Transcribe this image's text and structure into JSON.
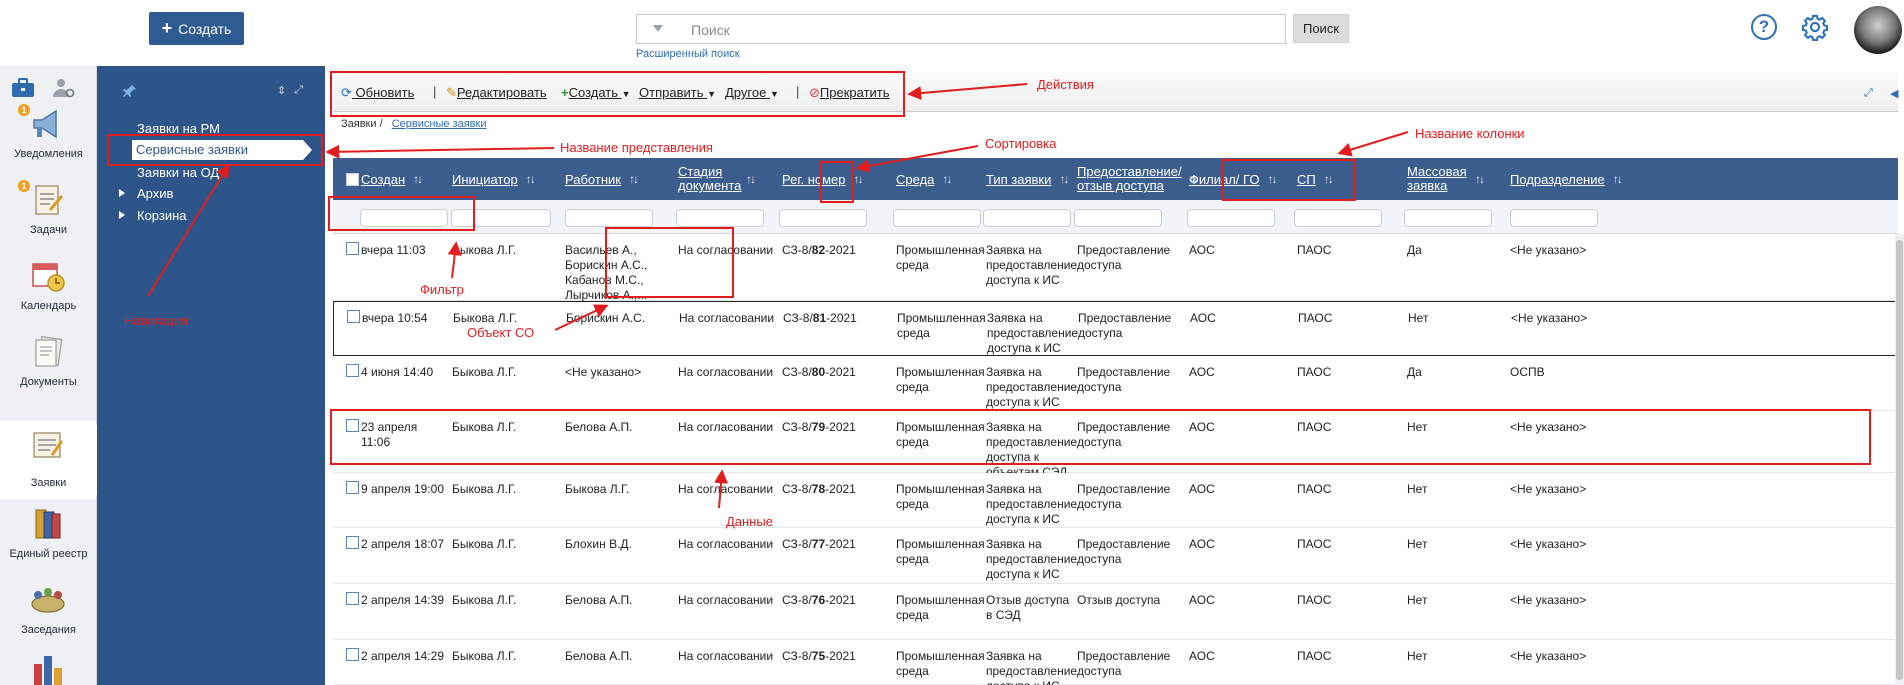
{
  "header": {
    "create_label": "Создать",
    "search_placeholder": "Поиск",
    "search_button": "Поиск",
    "advanced_search": "Расширенный поиск",
    "help_glyph": "?"
  },
  "nav": [
    {
      "label": "Уведомления",
      "badge": "1",
      "icon": "megaphone-icon"
    },
    {
      "label": "Задачи",
      "badge": "1",
      "icon": "clipboard-icon"
    },
    {
      "label": "Календарь",
      "badge": "",
      "icon": "calendar-icon"
    },
    {
      "label": "Документы",
      "badge": "",
      "icon": "documents-icon"
    },
    {
      "label": "Заявки",
      "badge": "",
      "icon": "requests-icon"
    },
    {
      "label": "Единый реестр",
      "badge": "",
      "icon": "registry-icon"
    },
    {
      "label": "Заседания",
      "badge": "",
      "icon": "meeting-icon"
    }
  ],
  "tree": {
    "items": [
      "Заявки на РМ",
      "Сервисные заявки",
      "Заявки на ОД",
      "Архив",
      "Корзина"
    ]
  },
  "toolbar": {
    "refresh": "Обновить",
    "edit": "Редактировать",
    "create": "Создать",
    "send": "Отправить",
    "other": "Другое",
    "stop": "Прекратить"
  },
  "breadcrumb": {
    "root": "Заявки",
    "sep": "/",
    "current": "Сервисные заявки"
  },
  "columns": [
    "Создан",
    "Инициатор",
    "Работник",
    "Стадия документа",
    "Рег. номер",
    "Среда",
    "Тип заявки",
    "Предоставление/ отзыв доступа",
    "Филиал/ ГО",
    "СП",
    "Массовая заявка",
    "Подразделение"
  ],
  "rows": [
    {
      "created": "вчера 11:03",
      "initiator": "Быкова Л.Г.",
      "worker": "Васильев А., Борискин А.С., Кабанов М.С., Лырчиков А.,...",
      "stage": "На согласовании",
      "reg_prefix": "СЗ-8/",
      "reg_num": "82",
      "reg_suffix": "-2021",
      "env": "Промышленная среда",
      "type": "Заявка на предоставление доступа к ИС",
      "access": "Предоставление доступа",
      "branch": "АОС",
      "sp": "ПАОС",
      "mass": "Да",
      "unit": "<Не указано>"
    },
    {
      "created": "вчера 10:54",
      "initiator": "Быкова Л.Г.",
      "worker": "Борискин А.С.",
      "stage": "На согласовании",
      "reg_prefix": "СЗ-8/",
      "reg_num": "81",
      "reg_suffix": "-2021",
      "env": "Промышленная среда",
      "type": "Заявка на предоставление доступа к ИС",
      "access": "Предоставление доступа",
      "branch": "АОС",
      "sp": "ПАОС",
      "mass": "Нет",
      "unit": "<Не указано>"
    },
    {
      "created": "4 июня 14:40",
      "initiator": "Быкова Л.Г.",
      "worker": "<Не указано>",
      "stage": "На согласовании",
      "reg_prefix": "СЗ-8/",
      "reg_num": "80",
      "reg_suffix": "-2021",
      "env": "Промышленная среда",
      "type": "Заявка на предоставление доступа к ИС",
      "access": "Предоставление доступа",
      "branch": "АОС",
      "sp": "ПАОС",
      "mass": "Да",
      "unit": "ОСПВ"
    },
    {
      "created": "23 апреля 11:06",
      "initiator": "Быкова Л.Г.",
      "worker": "Белова А.П.",
      "stage": "На согласовании",
      "reg_prefix": "СЗ-8/",
      "reg_num": "79",
      "reg_suffix": "-2021",
      "env": "Промышленная среда",
      "type": "Заявка на предоставление доступа к объектам СЭД",
      "access": "Предоставление доступа",
      "branch": "АОС",
      "sp": "ПАОС",
      "mass": "Нет",
      "unit": "<Не указано>"
    },
    {
      "created": "9 апреля 19:00",
      "initiator": "Быкова Л.Г.",
      "worker": "Быкова Л.Г.",
      "stage": "На согласовании",
      "reg_prefix": "СЗ-8/",
      "reg_num": "78",
      "reg_suffix": "-2021",
      "env": "Промышленная среда",
      "type": "Заявка на предоставление доступа к ИС",
      "access": "Предоставление доступа",
      "branch": "АОС",
      "sp": "ПАОС",
      "mass": "Нет",
      "unit": "<Не указано>"
    },
    {
      "created": "2 апреля 18:07",
      "initiator": "Быкова Л.Г.",
      "worker": "Блохин В.Д.",
      "stage": "На согласовании",
      "reg_prefix": "СЗ-8/",
      "reg_num": "77",
      "reg_suffix": "-2021",
      "env": "Промышленная среда",
      "type": "Заявка на предоставление доступа к ИС",
      "access": "Предоставление доступа",
      "branch": "АОС",
      "sp": "ПАОС",
      "mass": "Нет",
      "unit": "<Не указано>"
    },
    {
      "created": "2 апреля 14:39",
      "initiator": "Быкова Л.Г.",
      "worker": "Белова А.П.",
      "stage": "На согласовании",
      "reg_prefix": "СЗ-8/",
      "reg_num": "76",
      "reg_suffix": "-2021",
      "env": "Промышленная среда",
      "type": "Отзыв доступа в СЭД",
      "access": "Отзыв доступа",
      "branch": "АОС",
      "sp": "ПАОС",
      "mass": "Нет",
      "unit": "<Не указано>"
    },
    {
      "created": "2 апреля 14:29",
      "initiator": "Быкова Л.Г.",
      "worker": "Белова А.П.",
      "stage": "На согласовании",
      "reg_prefix": "СЗ-8/",
      "reg_num": "75",
      "reg_suffix": "-2021",
      "env": "Промышленная среда",
      "type": "Заявка на предоставление доступа к ИС",
      "access": "Предоставление доступа",
      "branch": "АОС",
      "sp": "ПАОС",
      "mass": "Нет",
      "unit": "<Не указано>"
    }
  ],
  "annotations": {
    "actions": "Действия",
    "view_name": "Название представления",
    "sorting": "Сортировка",
    "column_name": "Название колонки",
    "filter": "Фильтр",
    "object": "Объект СО",
    "data": "Данные",
    "navigation": "Навигация"
  },
  "colors": {
    "accent": "#2f5b93",
    "tree_bg": "#2e558a",
    "header_bg": "#3b5e8e",
    "annotation": "#e21d1d"
  }
}
